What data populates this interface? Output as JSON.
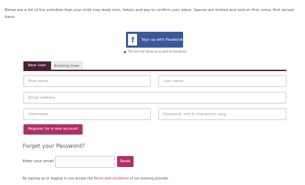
{
  "intro_text": "Below are a list of the activities that your child may book onto. Select and pay to confirm your place. Spaces are limited and sold on first come, first served basis.",
  "facebook": {
    "button_label": "Sign up with Facebook",
    "icon_glyph": "f",
    "note": "This will not allow us to post to Facebook",
    "color": "#3b5998"
  },
  "tabs": [
    {
      "label": "New User",
      "active": true
    },
    {
      "label": "Existing User",
      "active": false
    }
  ],
  "register_form": {
    "first_name_placeholder": "First name",
    "last_name_placeholder": "Last name",
    "email_placeholder": "Email address",
    "username_placeholder": "Username",
    "password_placeholder": "Password, min 6 characters long",
    "submit_label": "Register for a new account"
  },
  "forgot": {
    "title": "Forget your Password?",
    "email_label": "Enter your email",
    "email_value": "",
    "reset_label": "Reset"
  },
  "terms": {
    "prefix": "By signing up or logging in you accept the ",
    "link": "Terms and conditions",
    "suffix": " of our booking provider"
  },
  "colors": {
    "accent": "#b0306c",
    "tab_active": "#4a1e36"
  }
}
